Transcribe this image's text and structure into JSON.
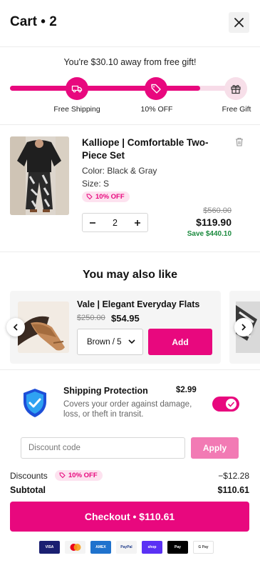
{
  "header": {
    "title": "Cart • 2"
  },
  "gift_progress": {
    "message": "You're $30.10 away from free gift!",
    "progress": 0.81,
    "milestones": [
      {
        "label": "Free Shipping",
        "icon": "truck-icon",
        "reached": true
      },
      {
        "label": "10% OFF",
        "icon": "tag-icon",
        "reached": true
      },
      {
        "label": "Free Gift",
        "icon": "gift-icon",
        "reached": false
      }
    ]
  },
  "cart_item": {
    "title": "Kalliope | Comfortable Two-Piece Set",
    "color": "Color: Black & Gray",
    "size": "Size: S",
    "badge": "10% OFF",
    "quantity": "2",
    "original_price": "$560.00",
    "price": "$119.90",
    "savings": "Save $440.10"
  },
  "recommendations": {
    "heading": "You may also like",
    "items": [
      {
        "title": "Vale | Elegant Everyday Flats",
        "original_price": "$250.00",
        "price": "$54.95",
        "variant": "Brown / 5",
        "add_label": "Add"
      }
    ]
  },
  "shipping_protection": {
    "title": "Shipping Protection",
    "price": "$2.99",
    "description": "Covers your order against damage, loss, or theft in transit.",
    "enabled": true
  },
  "discount": {
    "placeholder": "Discount code",
    "apply_label": "Apply"
  },
  "summary": {
    "discounts_label": "Discounts",
    "discount_badge": "10% OFF",
    "discounts_value": "−$12.28",
    "subtotal_label": "Subtotal",
    "subtotal_value": "$110.61"
  },
  "checkout": {
    "label": "Checkout • $110.61"
  },
  "payment_methods": [
    {
      "name": "VISA",
      "icon": "visa-icon"
    },
    {
      "name": "",
      "icon": "mastercard-icon"
    },
    {
      "name": "AMEX",
      "icon": "amex-icon"
    },
    {
      "name": "PayPal",
      "icon": "paypal-icon"
    },
    {
      "name": "shop",
      "icon": "shop-pay-icon"
    },
    {
      "name": "Pay",
      "icon": "apple-pay-icon"
    },
    {
      "name": "G Pay",
      "icon": "google-pay-icon"
    }
  ],
  "colors": {
    "accent": "#e8087e",
    "accent_light": "#f7dbe8",
    "save_green": "#1b8a3e"
  }
}
